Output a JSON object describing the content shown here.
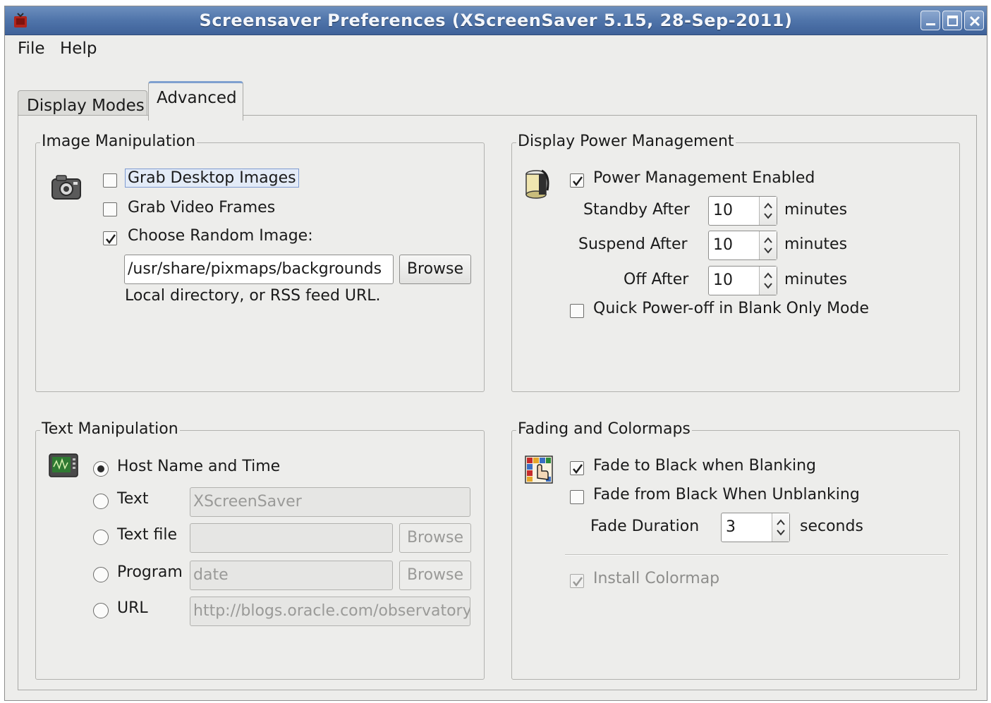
{
  "window": {
    "title": "Screensaver Preferences  (XScreenSaver 5.15, 28-Sep-2011)",
    "icons": [
      "minimize-icon",
      "maximize-icon",
      "close-icon"
    ]
  },
  "menu": {
    "file": "File",
    "help": "Help"
  },
  "tabs": {
    "display_modes": "Display Modes",
    "advanced": "Advanced",
    "selected": "Advanced"
  },
  "image_manipulation": {
    "title": "Image Manipulation",
    "grab_desktop": {
      "label": "Grab Desktop Images",
      "checked": false
    },
    "grab_video": {
      "label": "Grab Video Frames",
      "checked": false
    },
    "choose_random": {
      "label": "Choose Random Image:",
      "checked": true
    },
    "path_value": "/usr/share/pixmaps/backgrounds",
    "browse": "Browse",
    "hint": "Local directory, or RSS feed URL."
  },
  "text_manipulation": {
    "title": "Text Manipulation",
    "host_name": "Host Name and Time",
    "text": "Text",
    "text_value": "XScreenSaver",
    "text_file": "Text file",
    "text_file_value": "",
    "text_file_browse": "Browse",
    "program": "Program",
    "program_value": "date",
    "program_browse": "Browse",
    "url": "URL",
    "url_value": "http://blogs.oracle.com/observatory",
    "selected": "Host Name and Time"
  },
  "power": {
    "title": "Display Power Management",
    "enabled": {
      "label": "Power Management Enabled",
      "checked": true
    },
    "standby": "Standby After",
    "standby_value": "10",
    "suspend": "Suspend After",
    "suspend_value": "10",
    "off": "Off After",
    "off_value": "10",
    "minutes": "minutes",
    "quick_off": {
      "label": "Quick Power-off in Blank Only Mode",
      "checked": false
    }
  },
  "fading": {
    "title": "Fading and Colormaps",
    "fade_to_black": {
      "label": "Fade to Black when Blanking",
      "checked": true
    },
    "fade_from_black": {
      "label": "Fade from Black When Unblanking",
      "checked": false
    },
    "duration": "Fade Duration",
    "duration_value": "3",
    "seconds": "seconds",
    "install_colormap": {
      "label": "Install Colormap",
      "checked": true,
      "disabled": true
    }
  }
}
